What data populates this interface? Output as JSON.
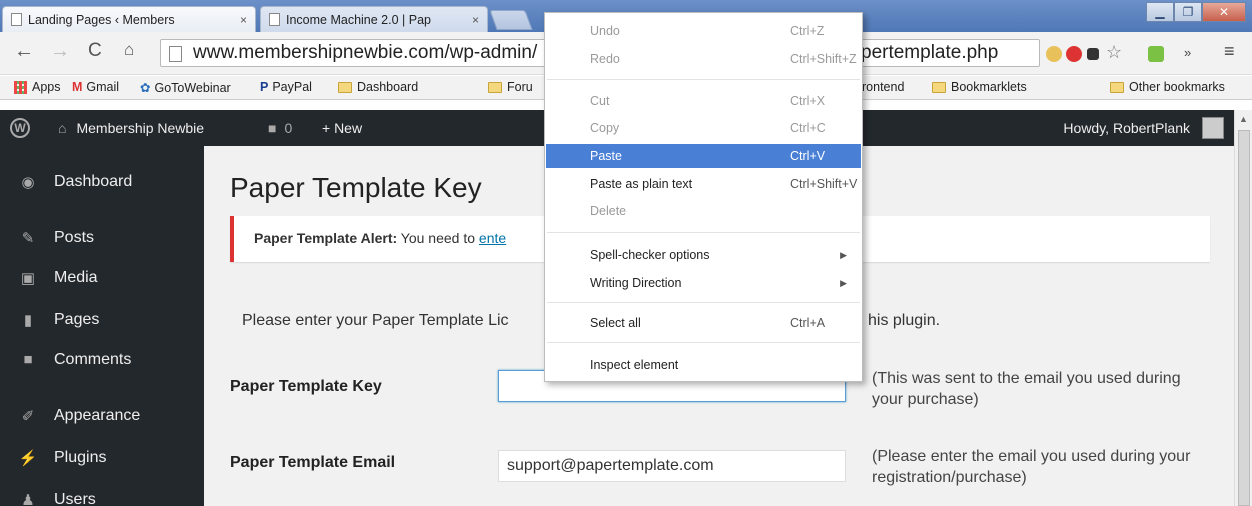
{
  "browser": {
    "tabs": [
      {
        "title": "Landing Pages ‹ Members",
        "close": "×"
      },
      {
        "title": "Income Machine 2.0 | Pap",
        "close": "×"
      }
    ],
    "window_controls": [
      "▁",
      "❐",
      "✕"
    ],
    "url_start": "www.membershipnewbie.com/wp-admin/",
    "url_end": "pertemplate.php",
    "overflow_chevron": "»",
    "menu_icon": "≡",
    "star_icon": "☆"
  },
  "bookmarks": {
    "apps": "Apps",
    "items": [
      "Gmail",
      "GoToWebinar",
      "PayPal",
      "Dashboard",
      "Foru",
      "rontend",
      "Bookmarklets"
    ],
    "other": "Other bookmarks"
  },
  "adminbar": {
    "site": "Membership Newbie",
    "comments_count": "0",
    "new_label": "+ New",
    "howdy": "Howdy, RobertPlank"
  },
  "sidebar": {
    "items": [
      {
        "label": "Dashboard",
        "icon": "dashboard-icon"
      },
      {
        "label": "Posts",
        "icon": "pin-icon"
      },
      {
        "label": "Media",
        "icon": "media-icon"
      },
      {
        "label": "Pages",
        "icon": "pages-icon"
      },
      {
        "label": "Comments",
        "icon": "comment-icon"
      },
      {
        "label": "Appearance",
        "icon": "brush-icon"
      },
      {
        "label": "Plugins",
        "icon": "plug-icon"
      },
      {
        "label": "Users",
        "icon": "users-icon"
      }
    ]
  },
  "main": {
    "title": "Paper Template Key",
    "notice_bold": "Paper Template Alert:",
    "notice_text": " You need to ",
    "notice_link": "ente",
    "intro": "Please enter your Paper Template Lic",
    "intro_end": "his plugin.",
    "key_label": "Paper Template Key",
    "key_value": "",
    "key_desc": "(This was sent to the email you used during your purchase)",
    "email_label": "Paper Template Email",
    "email_value": "support@papertemplate.com",
    "email_desc": "(Please enter the email you used during your registration/purchase)"
  },
  "context_menu": {
    "undo": "Undo",
    "undo_sc": "Ctrl+Z",
    "redo": "Redo",
    "redo_sc": "Ctrl+Shift+Z",
    "cut": "Cut",
    "cut_sc": "Ctrl+X",
    "copy": "Copy",
    "copy_sc": "Ctrl+C",
    "paste": "Paste",
    "paste_sc": "Ctrl+V",
    "paste_plain": "Paste as plain text",
    "paste_plain_sc": "Ctrl+Shift+V",
    "delete": "Delete",
    "spell": "Spell-checker options",
    "writing": "Writing Direction",
    "select_all": "Select all",
    "select_all_sc": "Ctrl+A",
    "inspect": "Inspect element"
  },
  "colors": {
    "highlight": "#4a7fd6",
    "admin_dark": "#23282d",
    "notice_red": "#dc3232"
  }
}
